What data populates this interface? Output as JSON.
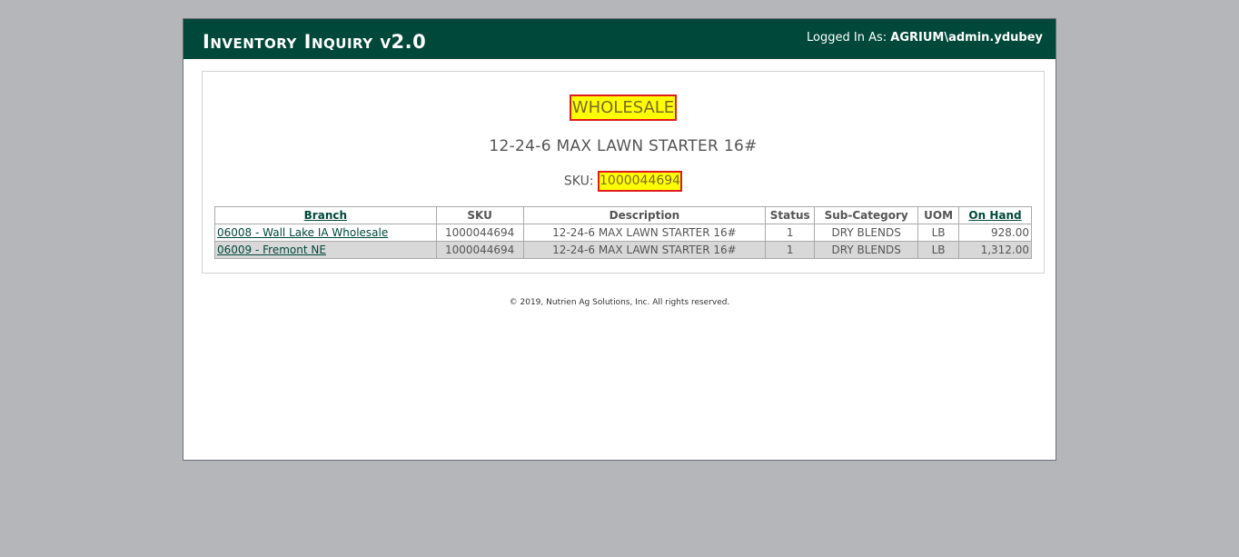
{
  "header": {
    "title": "Inventory Inquiry v2.0",
    "logged_in_label": "Logged In As:",
    "username": "AGRIUM\\admin.ydubey"
  },
  "product": {
    "channel": "WHOLESALE",
    "title": "12-24-6 MAX LAWN STARTER 16#",
    "sku_label": "SKU:",
    "sku": "1000044694"
  },
  "table": {
    "columns": [
      "Branch",
      "SKU",
      "Description",
      "Status",
      "Sub-Category",
      "UOM",
      "On Hand"
    ],
    "rows": [
      {
        "branch": "06008 - Wall Lake IA Wholesale",
        "sku": "1000044694",
        "description": "12-24-6 MAX LAWN STARTER 16#",
        "status": "1",
        "sub_category": "DRY BLENDS",
        "uom": "LB",
        "on_hand": "928.00"
      },
      {
        "branch": "06009 - Fremont NE",
        "sku": "1000044694",
        "description": "12-24-6 MAX LAWN STARTER 16#",
        "status": "1",
        "sub_category": "DRY BLENDS",
        "uom": "LB",
        "on_hand": "1,312.00"
      }
    ]
  },
  "footer": {
    "copyright": "© 2019, Nutrien Ag Solutions, Inc. All rights reserved."
  },
  "colors": {
    "header_bg": "#00483a",
    "highlight_bg": "#ffff00",
    "highlight_border": "#e01b1b",
    "page_bg": "#b5b6ba"
  }
}
